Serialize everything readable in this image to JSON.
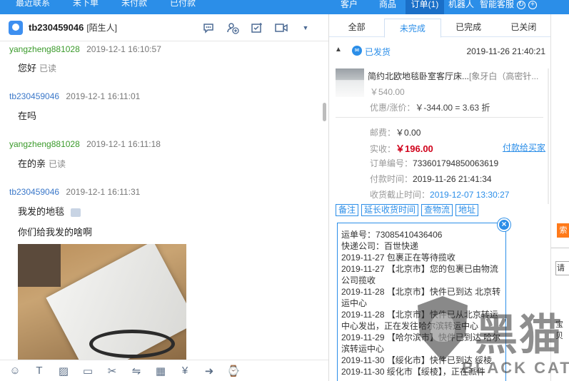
{
  "top": {
    "left_tabs": [
      "最近联系",
      "未下单",
      "未付款",
      "已付款"
    ],
    "right_tabs": [
      {
        "label": "客户",
        "active": false
      },
      {
        "label": "商品",
        "active": false
      },
      {
        "label": "订单(1)",
        "active": true
      },
      {
        "label": "机器人",
        "active": false
      },
      {
        "label": "智能客服",
        "active": false
      }
    ],
    "icons": [
      "refresh-icon",
      "add-icon"
    ]
  },
  "chat": {
    "contact_name": "tb230459046",
    "contact_tag": "[陌生人]",
    "header_icons": [
      "chat-bubble-icon",
      "add-contact-icon",
      "checklist-icon",
      "video-icon",
      "more-icon"
    ],
    "messages": [
      {
        "sender": "yangzheng881028",
        "time": "2019-12-1 16:10:57",
        "text": "您好",
        "status": "已读",
        "role": "seller"
      },
      {
        "sender": "tb230459046",
        "time": "2019-12-1 16:11:01",
        "text": "在吗",
        "status": "",
        "role": "buyer"
      },
      {
        "sender": "yangzheng881028",
        "time": "2019-12-1 16:11:18",
        "text": "在的亲",
        "status": "已读",
        "role": "seller"
      },
      {
        "sender": "tb230459046",
        "time": "2019-12-1 16:11:31",
        "text": "我发的地毯",
        "status": "",
        "role": "buyer"
      },
      {
        "sender": "",
        "time": "",
        "text": "你们给我发的啥啊",
        "status": "",
        "role": "buyer"
      }
    ]
  },
  "toolbar": {
    "icons": [
      "emoji-icon",
      "text-format-icon",
      "image-icon",
      "folder-icon",
      "scissors-icon",
      "transfer-icon",
      "calculator-icon",
      "coupon-icon",
      "forward-icon",
      "history-icon"
    ]
  },
  "order": {
    "tabs": [
      {
        "label": "全部",
        "active": false
      },
      {
        "label": "未完成",
        "active": true
      },
      {
        "label": "已完成",
        "active": false
      },
      {
        "label": "已关闭",
        "active": false
      }
    ],
    "status": "已发货",
    "date": "2019-11-26 21:40:21",
    "product": {
      "title": "简约北欧地毯卧室客厅床...",
      "attr": "[象牙白（高密针...",
      "price": "￥540.00"
    },
    "discount_label": "优惠/涨价：",
    "discount_value": "￥-344.00 = 3.63 折",
    "shipping_label": "邮费：",
    "shipping_value": "￥0.00",
    "paid_label": "实收：",
    "paid_value": "￥196.00",
    "pay_link": "付款给买家",
    "order_no_label": "订单编号：",
    "order_no": "733601794850063619",
    "pay_time_label": "付款时间：",
    "pay_time": "2019-11-26 21:41:34",
    "receive_deadline_label": "收货截止时间：",
    "receive_deadline": "2019-12-07 13:30:27",
    "buttons": [
      "备注",
      "延长收货时间",
      "查物流",
      "地址"
    ]
  },
  "logistics": {
    "tracking_label": "运单号：",
    "tracking_no": "73085410436406",
    "company_label": "快递公司：",
    "company": "百世快递",
    "entries": [
      {
        "date": "2019-11-27",
        "text": "包裹正在等待揽收"
      },
      {
        "date": "2019-11-27",
        "text": "【北京市】您的包裹已由物流公司揽收"
      },
      {
        "date": "2019-11-28",
        "text": "【北京市】快件已到达 北京转运中心"
      },
      {
        "date": "2019-11-28",
        "text": "【北京市】快件已从北京转运中心发出，正在发往哈尔滨转运中心"
      },
      {
        "date": "2019-11-29",
        "text": "【哈尔滨市】快件已到达 哈尔滨转运中心"
      },
      {
        "date": "2019-11-30",
        "text": "【绥化市】快件已到达 绥棱"
      },
      {
        "date": "2019-11-30",
        "text": "绥化市【绥棱】，正在派件"
      }
    ]
  },
  "far_right": {
    "orange_label": "索",
    "input_text": "请选",
    "small_text": "宝贝"
  },
  "watermark": {
    "cn": "黑猫",
    "en": "BLACK CAT"
  },
  "colors": {
    "brand_blue": "#2b8ee8",
    "seller_name": "#3a9a2a",
    "buyer_name": "#3b78c9",
    "price_red": "#d0021b",
    "accent_orange": "#ff7a1a"
  }
}
